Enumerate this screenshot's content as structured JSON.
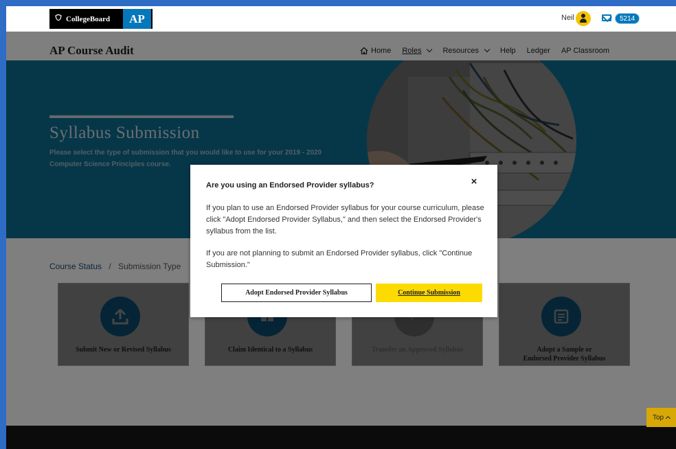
{
  "header": {
    "brand": "CollegeBoard",
    "ap_badge": "AP",
    "user_name": "Neil",
    "message_count": "5214"
  },
  "nav": {
    "app_title": "AP Course Audit",
    "items": [
      {
        "label": "Home",
        "icon": "home-icon",
        "active": false,
        "dropdown": false
      },
      {
        "label": "Roles",
        "active": true,
        "dropdown": true
      },
      {
        "label": "Resources",
        "active": false,
        "dropdown": true
      },
      {
        "label": "Help",
        "active": false,
        "dropdown": false
      },
      {
        "label": "Ledger",
        "active": false,
        "dropdown": false
      },
      {
        "label": "AP Classroom",
        "active": false,
        "dropdown": false
      }
    ]
  },
  "hero": {
    "title": "Syllabus Submission",
    "subtitle": "Please select the type of submission that you would like to use for your 2019 - 2020 Computer Science Principles course."
  },
  "breadcrumb": {
    "link": "Course Status",
    "separator": "/",
    "current": "Submission Type"
  },
  "cards": [
    {
      "label": "Submit New or Revised Syllabus",
      "icon": "upload-icon",
      "disabled": false
    },
    {
      "label": "Claim Identical to a Syllabus",
      "icon": "copy-icon",
      "disabled": false
    },
    {
      "label": "Transfer an Approved Syllabus",
      "icon": "transfer-icon",
      "disabled": true
    },
    {
      "label_line1": "Adopt a Sample or",
      "label_line2": "Endorsed Provider Syllabus",
      "icon": "document-icon",
      "disabled": false
    }
  ],
  "top_button": "Top",
  "modal": {
    "title": "Are you using an Endorsed Provider syllabus?",
    "close": "×",
    "paragraph1": "If you plan to use an Endorsed Provider syllabus for your course curriculum, please click \"Adopt Endorsed Provider Syllabus,\" and then select the Endorsed Provider's syllabus from the list.",
    "paragraph2": "If you are not planning to submit an Endorsed Provider syllabus, click \"Continue Submission.\"",
    "secondary_button": "Adopt Endorsed Provider Syllabus",
    "primary_button": "Continue Submission"
  },
  "colors": {
    "accent_blue": "#0677ba",
    "hero_blue": "#0d6e93",
    "primary_yellow": "#fedb00",
    "frame_blue": "#2e6cc6"
  }
}
